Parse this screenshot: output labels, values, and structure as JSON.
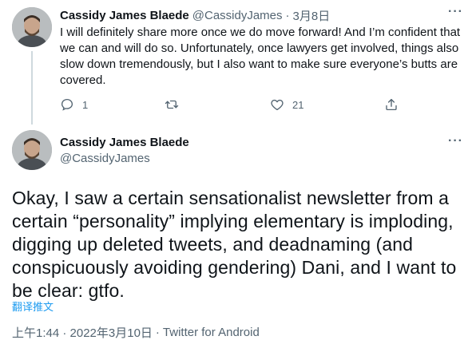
{
  "reply_tweet": {
    "author_name": "Cassidy James Blaede",
    "author_handle": "@CassidyJames",
    "separator": "·",
    "date": "3月8日",
    "text": "I will definitely share more once we do move forward! And I’m confident that we can and will do so. Unfortunately, once lawyers get involved, things also slow down tremendously, but I also want to make sure everyone’s butts are covered.",
    "reply_count": "1",
    "retweet_count": "",
    "like_count": "21",
    "more_label": "···"
  },
  "main_tweet": {
    "author_name": "Cassidy James Blaede",
    "author_handle": "@CassidyJames",
    "more_label": "···",
    "text": "Okay, I saw a certain sensationalist newsletter from a certain “personality” implying elementary is imploding, digging up deleted tweets, and deadnaming (and conspicuously avoiding gendering) Dani, and I want to be clear: gtfo.",
    "translate_label": "翻译推文",
    "timestamp": "上午1:44 · 2022年3月10日",
    "meta_separator": "·",
    "source": "Twitter for Android"
  },
  "colors": {
    "text_primary": "#0f1419",
    "text_secondary": "#536471",
    "link": "#1d9bf0",
    "thread_line": "#cfd9de"
  }
}
